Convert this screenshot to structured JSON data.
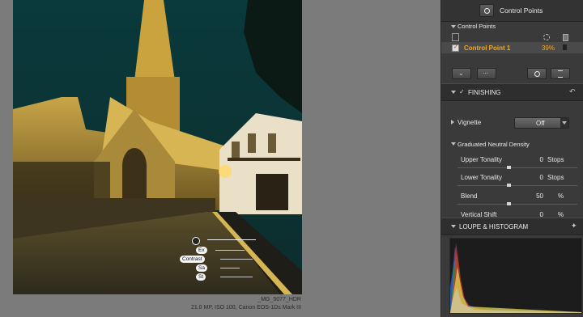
{
  "image": {
    "filename": "_MG_5077_HDR",
    "info": "21.0 MP, ISO 100, Canon EOS-1Ds Mark III"
  },
  "control_point_overlay": {
    "labels": [
      "Ex",
      "Contrast",
      "Sa",
      "St"
    ]
  },
  "panel": {
    "title": "Control Points",
    "control_points_section": "Control Points",
    "control_point_name": "Control Point 1",
    "control_point_value": "39%",
    "control_point_color": "#f2a62a",
    "finishing_label": "FINISHING",
    "vignette_label": "Vignette",
    "vignette_value": "Off",
    "gnd_label": "Graduated Neutral Density",
    "gnd": [
      {
        "label": "Upper Tonality",
        "value": "0",
        "unit": "Stops",
        "level": 0.5
      },
      {
        "label": "Lower Tonality",
        "value": "0",
        "unit": "Stops",
        "level": 0.5
      },
      {
        "label": "Blend",
        "value": "50",
        "unit": "%",
        "level": 0.5
      },
      {
        "label": "Vertical Shift",
        "value": "0",
        "unit": "%",
        "level": 0.5
      }
    ],
    "loupe_label": "LOUPE & HISTOGRAM"
  },
  "icons": {
    "control_points_logo": "target-icon",
    "finishing_check": "check-icon",
    "reset": "undo-icon",
    "pin": "pin-icon"
  }
}
